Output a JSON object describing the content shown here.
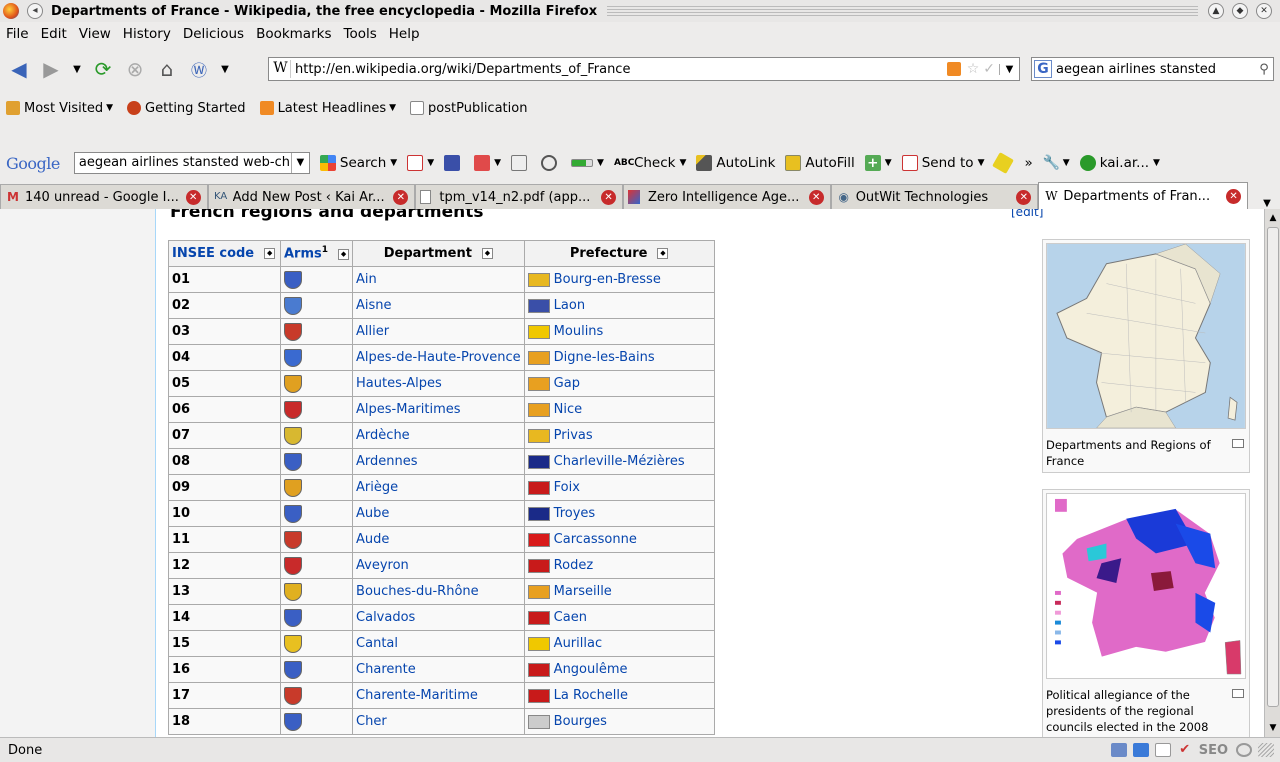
{
  "window": {
    "title": "Departments of France - Wikipedia, the free encyclopedia - Mozilla Firefox"
  },
  "menu": [
    "File",
    "Edit",
    "View",
    "History",
    "Delicious",
    "Bookmarks",
    "Tools",
    "Help"
  ],
  "nav": {
    "url": "http://en.wikipedia.org/wiki/Departments_of_France",
    "search_value": "aegean airlines stansted"
  },
  "bookmarks": [
    "Most Visited",
    "Getting Started",
    "Latest Headlines",
    "postPublication"
  ],
  "google_toolbar": {
    "logo": "Google",
    "search_value": "aegean airlines stansted web-ch",
    "items": [
      "Search",
      "Check",
      "AutoLink",
      "AutoFill",
      "Send to",
      "»",
      "kai.ar..."
    ]
  },
  "tabs": [
    {
      "label": "140 unread - Google I...",
      "icon": "gmail-icon"
    },
    {
      "label": "Add New Post ‹ Kai Ar...",
      "icon": "wordpress-icon"
    },
    {
      "label": "tpm_v14_n2.pdf (app...",
      "icon": "page-icon"
    },
    {
      "label": "Zero Intelligence Age...",
      "icon": "page-icon"
    },
    {
      "label": "OutWit Technologies",
      "icon": "outwit-icon"
    },
    {
      "label": "Departments of Fran...",
      "icon": "wikipedia-icon"
    }
  ],
  "article": {
    "heading": "French regions and departments",
    "edit": "[edit]",
    "columns": {
      "code": "INSEE code",
      "arms": "Arms",
      "arms_sup": "1",
      "department": "Department",
      "prefecture": "Prefecture"
    },
    "rows": [
      {
        "code": "01",
        "department": "Ain",
        "prefecture": "Bourg-en-Bresse",
        "arms_color": "#3a5fc4",
        "flag_color": "#e8b820"
      },
      {
        "code": "02",
        "department": "Aisne",
        "prefecture": "Laon",
        "arms_color": "#4a7bd0",
        "flag_color": "#3a4fa8"
      },
      {
        "code": "03",
        "department": "Allier",
        "prefecture": "Moulins",
        "arms_color": "#c83a2a",
        "flag_color": "#f0c800"
      },
      {
        "code": "04",
        "department": "Alpes-de-Haute-Provence",
        "prefecture": "Digne-les-Bains",
        "arms_color": "#3a6ad0",
        "flag_color": "#e8a020"
      },
      {
        "code": "05",
        "department": "Hautes-Alpes",
        "prefecture": "Gap",
        "arms_color": "#e0a020",
        "flag_color": "#e8a020"
      },
      {
        "code": "06",
        "department": "Alpes-Maritimes",
        "prefecture": "Nice",
        "arms_color": "#c82a2a",
        "flag_color": "#e8a020"
      },
      {
        "code": "07",
        "department": "Ardèche",
        "prefecture": "Privas",
        "arms_color": "#d8b830",
        "flag_color": "#e8b820"
      },
      {
        "code": "08",
        "department": "Ardennes",
        "prefecture": "Charleville-Mézières",
        "arms_color": "#3a5fc4",
        "flag_color": "#1a2a88"
      },
      {
        "code": "09",
        "department": "Ariège",
        "prefecture": "Foix",
        "arms_color": "#e0a020",
        "flag_color": "#c81a1a"
      },
      {
        "code": "10",
        "department": "Aube",
        "prefecture": "Troyes",
        "arms_color": "#3a5fc4",
        "flag_color": "#1a2a88"
      },
      {
        "code": "11",
        "department": "Aude",
        "prefecture": "Carcassonne",
        "arms_color": "#c83a2a",
        "flag_color": "#d81a1a"
      },
      {
        "code": "12",
        "department": "Aveyron",
        "prefecture": "Rodez",
        "arms_color": "#c82a2a",
        "flag_color": "#c81a1a"
      },
      {
        "code": "13",
        "department": "Bouches-du-Rhône",
        "prefecture": "Marseille",
        "arms_color": "#e0b020",
        "flag_color": "#e8a020"
      },
      {
        "code": "14",
        "department": "Calvados",
        "prefecture": "Caen",
        "arms_color": "#3a5fc4",
        "flag_color": "#c81a1a"
      },
      {
        "code": "15",
        "department": "Cantal",
        "prefecture": "Aurillac",
        "arms_color": "#e8c020",
        "flag_color": "#f0c800"
      },
      {
        "code": "16",
        "department": "Charente",
        "prefecture": "Angoulême",
        "arms_color": "#3a5fc4",
        "flag_color": "#c81a1a"
      },
      {
        "code": "17",
        "department": "Charente-Maritime",
        "prefecture": "La Rochelle",
        "arms_color": "#c83a2a",
        "flag_color": "#c81a1a"
      },
      {
        "code": "18",
        "department": "Cher",
        "prefecture": "Bourges",
        "arms_color": "#3a5fc4",
        "flag_color": "#cccccc"
      }
    ],
    "thumb1_caption": "Departments and Regions of France",
    "thumb2_caption": "Political allegiance of the presidents of the regional councils elected in the 2008"
  },
  "status": {
    "text": "Done",
    "seo": "SEO"
  }
}
